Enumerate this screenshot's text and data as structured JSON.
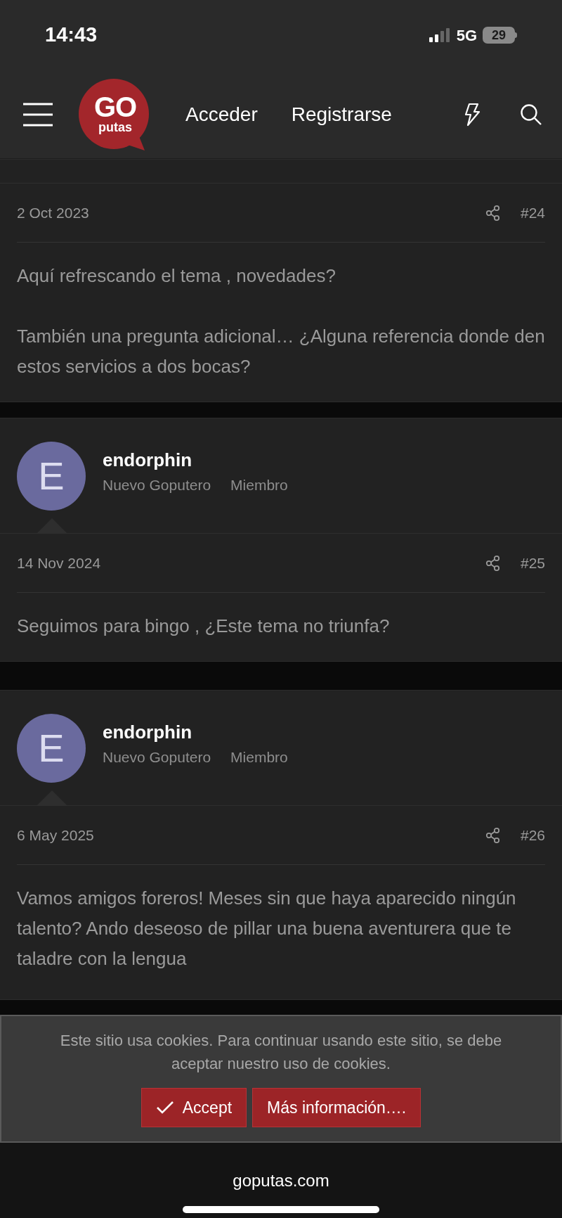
{
  "status_bar": {
    "time": "14:43",
    "network": "5G",
    "battery": "29"
  },
  "header": {
    "logo_top": "GO",
    "logo_bottom": "putas",
    "links": [
      "Acceder",
      "Registrarse"
    ]
  },
  "posts": [
    {
      "date": "2 Oct 2023",
      "number": "#24",
      "paragraphs": [
        "Aquí refrescando el tema , novedades?",
        "También una pregunta adicional… ¿Alguna referencia donde den estos servicios a dos bocas?"
      ]
    },
    {
      "user": {
        "initial": "E",
        "name": "endorphin",
        "title": "Nuevo Goputero",
        "role": "Miembro"
      },
      "date": "14 Nov 2024",
      "number": "#25",
      "paragraphs": [
        "Seguimos para bingo , ¿Este tema no triunfa?"
      ]
    },
    {
      "user": {
        "initial": "E",
        "name": "endorphin",
        "title": "Nuevo Goputero",
        "role": "Miembro"
      },
      "date": "6 May 2025",
      "number": "#26",
      "paragraphs": [
        "Vamos amigos foreros! Meses sin que haya aparecido ningún talento? Ando deseoso de pillar una buena aventurera que te taladre con la lengua"
      ]
    }
  ],
  "cookie_notice": {
    "text": "Este sitio usa cookies. Para continuar usando este sitio, se debe aceptar nuestro uso de cookies.",
    "buttons": [
      "Accept",
      "Más información…."
    ]
  },
  "browser": {
    "url": "goputas.com"
  }
}
